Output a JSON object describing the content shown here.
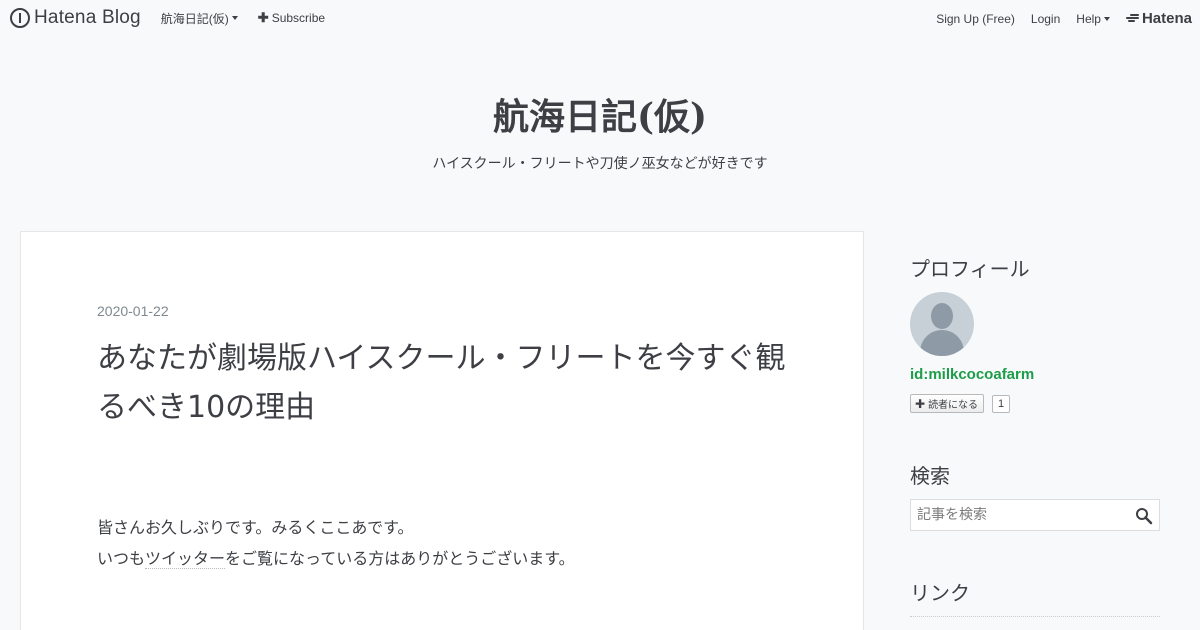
{
  "globalheader": {
    "logo_text": "Hatena Blog",
    "blog_menu": "航海日記(仮)",
    "subscribe": "Subscribe",
    "signup": "Sign Up (Free)",
    "login": "Login",
    "help": "Help",
    "brand": "Hatena"
  },
  "blog": {
    "title": "航海日記(仮)",
    "description": "ハイスクール・フリートや刀使ノ巫女などが好きです"
  },
  "entry": {
    "date": "2020-01-22",
    "title": "あなたが劇場版ハイスクール・フリートを今すぐ観るべき10の理由",
    "body_line1": "皆さんお久しぶりです。みるくここあです。",
    "body_line2_before": "いつも",
    "body_line2_keyword": "ツイッター",
    "body_line2_after": "をご覧になっている方はありがとうございます。"
  },
  "sidebar": {
    "profile_heading": "プロフィール",
    "profile_id": "id:milkcocoafarm",
    "subscribe_label": "読者になる",
    "subscriber_count": "1",
    "search_heading": "検索",
    "search_placeholder": "記事を検索",
    "links_heading": "リンク"
  },
  "icons": {
    "logo": "hatena-blog-logo-icon",
    "search": "search-icon",
    "avatar": "default-avatar-icon"
  },
  "colors": {
    "background": "#f8f9fa",
    "text": "#3d3f44",
    "accent_green": "#1d9c4a",
    "date_gray": "#7f8a90"
  }
}
